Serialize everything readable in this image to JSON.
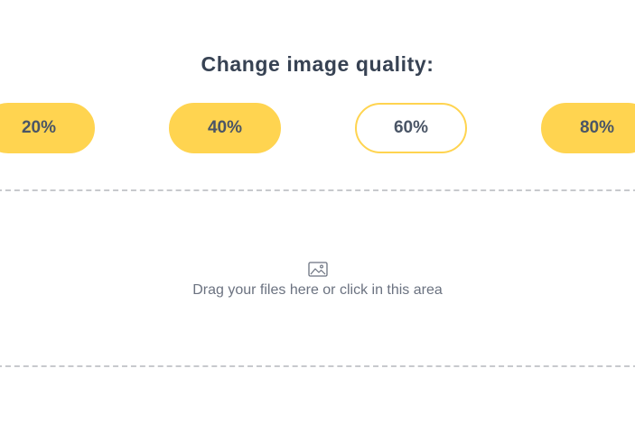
{
  "heading": "Change image quality:",
  "quality_options": [
    {
      "label": "20%",
      "selected": false
    },
    {
      "label": "40%",
      "selected": false
    },
    {
      "label": "60%",
      "selected": true
    },
    {
      "label": "80%",
      "selected": false
    }
  ],
  "dropzone": {
    "icon": "image-icon",
    "text": "Drag your files here or click in this area"
  },
  "colors": {
    "accent": "#ffd450",
    "heading_text": "#374253",
    "button_text": "#4a5566",
    "muted_text": "#6b7280",
    "dashed_border": "#c7c9cd"
  }
}
